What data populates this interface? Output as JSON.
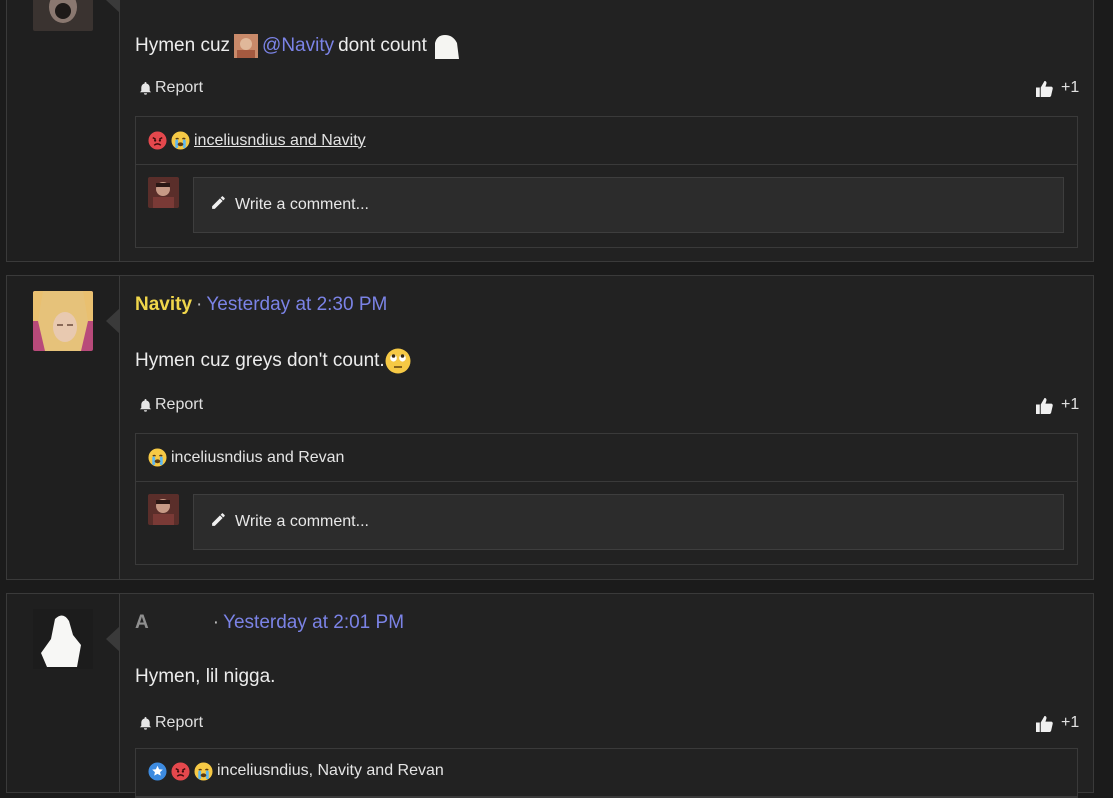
{
  "actions": {
    "report_label": "Report",
    "like_label": "+1"
  },
  "comment": {
    "placeholder": "Write a comment..."
  },
  "posts": [
    {
      "username": "",
      "timestamp": "",
      "message_prefix": "Hymen cuz",
      "mention": "@Navity",
      "message_suffix": "dont count",
      "reactions_text": "inceliusndius and Navity",
      "reaction_icons": [
        "angry-emoji-icon",
        "crying-emoji-icon"
      ]
    },
    {
      "username": "Navity",
      "separator": "·",
      "timestamp": "Yesterday at 2:30 PM",
      "message": "Hymen cuz greys don't count.",
      "reactions_text": "inceliusndius and Revan",
      "reaction_icons": [
        "crying-emoji-icon"
      ]
    },
    {
      "username": "A",
      "separator": "·",
      "timestamp": "Yesterday at 2:01 PM",
      "message": "Hymen, lil nigga.",
      "reactions_text": "inceliusndius, Navity and Revan",
      "reaction_icons": [
        "star-badge-icon",
        "angry-emoji-icon",
        "crying-emoji-icon"
      ]
    }
  ],
  "colors": {
    "username": "#f0d64b",
    "link": "#7b83e6",
    "background": "#1b1b1b",
    "panel": "#222222"
  }
}
